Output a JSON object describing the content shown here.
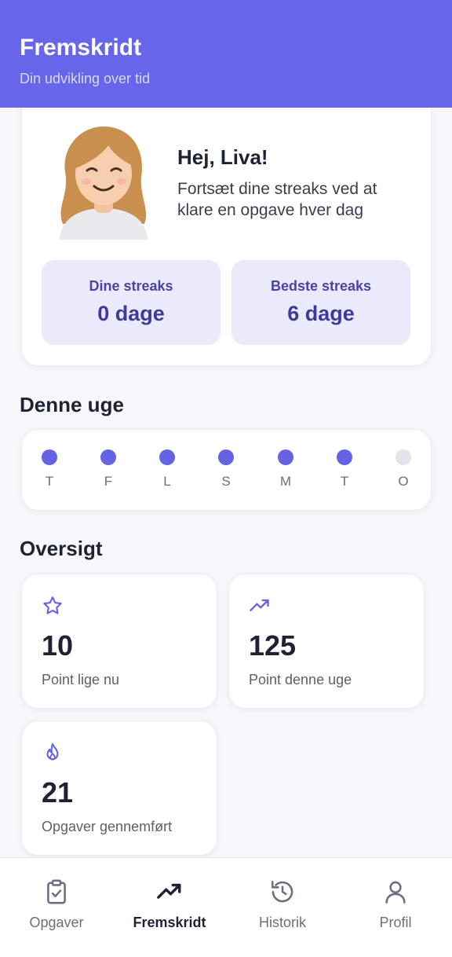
{
  "header": {
    "title": "Fremskridt",
    "subtitle": "Din udvikling over tid"
  },
  "profile": {
    "greeting": "Hej, Liva!",
    "message": "Fortsæt dine streaks ved at klare en opgave hver dag",
    "avatar_icon": "girl-avatar",
    "streaks": {
      "current_label": "Dine streaks",
      "current_value": "0 dage",
      "best_label": "Bedste streaks",
      "best_value": "6 dage"
    }
  },
  "week": {
    "title": "Denne uge",
    "days": [
      {
        "label": "T",
        "done": true
      },
      {
        "label": "F",
        "done": true
      },
      {
        "label": "L",
        "done": true
      },
      {
        "label": "S",
        "done": true
      },
      {
        "label": "M",
        "done": true
      },
      {
        "label": "T",
        "done": true
      },
      {
        "label": "O",
        "done": false
      }
    ],
    "active_color": "#6563e3",
    "inactive_color": "#e3e3ea"
  },
  "overview": {
    "title": "Oversigt",
    "stats": [
      {
        "icon": "star-icon",
        "value": "10",
        "label": "Point lige nu"
      },
      {
        "icon": "trending-up-icon",
        "value": "125",
        "label": "Point denne uge"
      },
      {
        "icon": "flame-icon",
        "value": "21",
        "label": "Opgaver gennemført"
      }
    ]
  },
  "nav": {
    "items": [
      {
        "label": "Opgaver",
        "icon": "clipboard-check-icon",
        "active": false
      },
      {
        "label": "Fremskridt",
        "icon": "trending-up-icon",
        "active": true
      },
      {
        "label": "Historik",
        "icon": "history-icon",
        "active": false
      },
      {
        "label": "Profil",
        "icon": "user-icon",
        "active": false
      }
    ]
  },
  "colors": {
    "accent": "#6766ea",
    "streak_bg": "#ebeafc",
    "text_dark": "#1f2233"
  }
}
